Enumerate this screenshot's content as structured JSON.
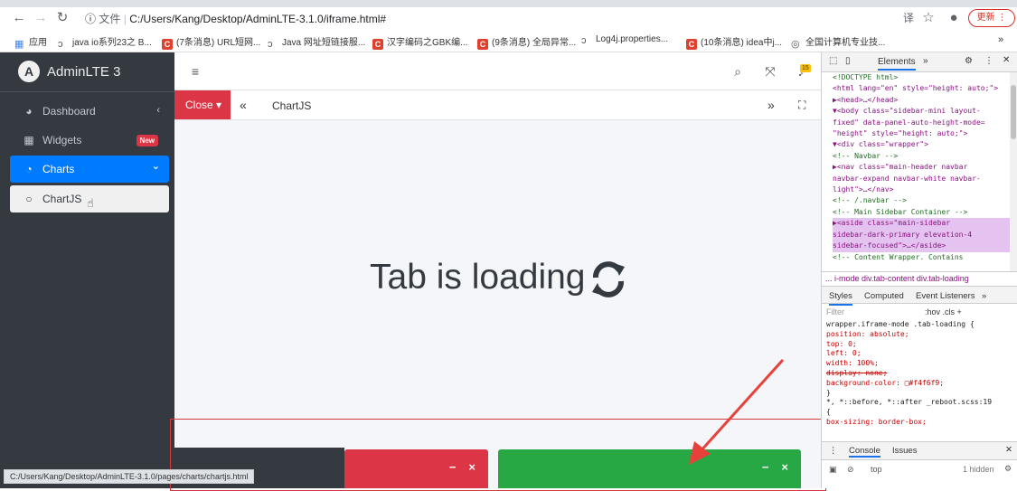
{
  "browser": {
    "url_scheme_label": "文件",
    "url": "C:/Users/Kang/Desktop/AdminLTE-3.1.0/iframe.html#",
    "update_label": "更新",
    "bookmarks": [
      {
        "icon": "apps-grid-icon",
        "label": "应用"
      },
      {
        "icon": "leaf-icon",
        "label": "java io系列23之 B..."
      },
      {
        "icon": "csdn-icon",
        "label": "(7条消息) URL短网..."
      },
      {
        "icon": "leaf-icon",
        "label": "Java 网址短链接服..."
      },
      {
        "icon": "csdn-icon",
        "label": "汉字编码之GBK编..."
      },
      {
        "icon": "csdn-icon",
        "label": "(9条消息) 全局异常..."
      },
      {
        "icon": "leaf-icon",
        "label": "Log4j.properties..."
      },
      {
        "icon": "csdn-icon",
        "label": "(10条消息) idea中j..."
      },
      {
        "icon": "globe-icon",
        "label": "全国计算机专业技..."
      }
    ],
    "status_url": "C:/Users/Kang/Desktop/AdminLTE-3.1.0/pages/charts/chartjs.html"
  },
  "app": {
    "brand": {
      "logo": "A",
      "title": "AdminLTE 3"
    },
    "sidebar": {
      "items": [
        {
          "label": "Dashboard",
          "icon": "dashboard-icon",
          "right": "‹"
        },
        {
          "label": "Widgets",
          "icon": "widgets-icon",
          "badge": "New"
        },
        {
          "label": "Charts",
          "icon": "pie-chart-icon",
          "right": "⌄"
        },
        {
          "label": "ChartJS",
          "icon": "circle-icon"
        }
      ]
    },
    "topnav": {
      "notification_count": "15"
    },
    "tabbar": {
      "close_label": "Close",
      "tab_title": "ChartJS"
    },
    "content": {
      "loading_text": "Tab is loading"
    },
    "cards": {
      "minus": "−",
      "close": "×"
    }
  },
  "devtools": {
    "elements_tab": "Elements",
    "dom_lines": [
      {
        "text": "<!DOCTYPE html>",
        "cls": "c"
      },
      {
        "text": "<html lang=\"en\" style=\"height: auto;\">"
      },
      {
        "text": "▶<head>…</head>"
      },
      {
        "text": "▼<body class=\"sidebar-mini layout-"
      },
      {
        "text": "fixed\" data-panel-auto-height-mode="
      },
      {
        "text": "\"height\" style=\"height: auto;\">"
      },
      {
        "text": "  ▼<div class=\"wrapper\">"
      },
      {
        "text": "      <!-- Navbar -->",
        "cls": "c"
      },
      {
        "text": "    ▶<nav class=\"main-header navbar"
      },
      {
        "text": "    navbar-expand navbar-white navbar-"
      },
      {
        "text": "    light\">…</nav>"
      },
      {
        "text": "      <!-- /.navbar -->",
        "cls": "c"
      },
      {
        "text": "      <!-- Main Sidebar Container -->",
        "cls": "c"
      },
      {
        "text": "    ▶<aside class=\"main-sidebar",
        "cls": "hl"
      },
      {
        "text": "    sidebar-dark-primary elevation-4",
        "cls": "hl"
      },
      {
        "text": "    sidebar-focused\">…</aside>",
        "cls": "hl"
      },
      {
        "text": "      <!-- Content Wrapper. Contains",
        "cls": "c"
      }
    ],
    "breadcrumb": "... i-mode   div.tab-content   div.tab-loading",
    "styles_tabs": [
      "Styles",
      "Computed",
      "Event Listeners",
      "»"
    ],
    "filter_placeholder": "Filter",
    "filter_right": ":hov  .cls  +",
    "css_lines": [
      {
        "text": "wrapper.iframe-mode .tab-loading {",
        "cls": "sel"
      },
      {
        "text": "  position: absolute;",
        "cls": "p"
      },
      {
        "text": "  top: 0;",
        "cls": "p"
      },
      {
        "text": "  left: 0;",
        "cls": "p"
      },
      {
        "text": "  width: 100%;",
        "cls": "p"
      },
      {
        "text": "  display: none;",
        "cls": "p"
      },
      {
        "text": "  background-color: □#f4f6f9;",
        "cls": "p"
      },
      {
        "text": "}",
        "cls": "sel"
      },
      {
        "text": "*, *::before, *::after    _reboot.scss:19",
        "cls": "sel"
      },
      {
        "text": "{",
        "cls": "sel"
      },
      {
        "text": "  box-sizing: border-box;",
        "cls": "p"
      }
    ],
    "console_tabs": [
      "Console",
      "Issues"
    ],
    "console_context": "top",
    "console_hidden": "1 hidden"
  }
}
